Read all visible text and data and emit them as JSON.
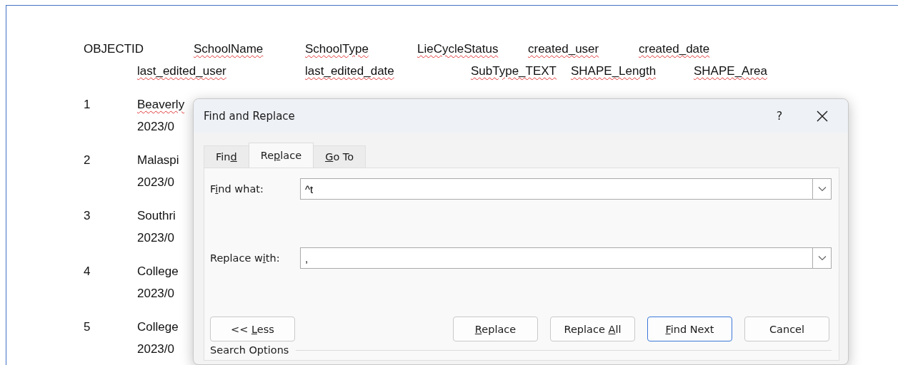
{
  "document": {
    "header_lines": [
      [
        {
          "text": "OBJECTID",
          "misspelled": false
        },
        {
          "text": "SchoolName",
          "misspelled": true
        },
        {
          "text": "SchoolType",
          "misspelled": true
        },
        {
          "text": "LieCycleStatus",
          "misspelled": true
        },
        {
          "text": "created_user",
          "misspelled": true
        },
        {
          "text": "created_date",
          "misspelled": true
        }
      ],
      [
        {
          "text": "last_edited_user",
          "misspelled": true
        },
        {
          "text": "last_edited_date",
          "misspelled": true
        },
        {
          "text": "SubType_TEXT",
          "misspelled": true
        },
        {
          "text": "SHAPE_Length",
          "misspelled": true
        },
        {
          "text": "SHAPE_Area",
          "misspelled": true
        }
      ]
    ],
    "rows": [
      {
        "id": "1",
        "name": "Beaverly",
        "misspelled": true,
        "date": "2023/0"
      },
      {
        "id": "2",
        "name": "Malaspi",
        "misspelled": false,
        "date": "2023/0"
      },
      {
        "id": "3",
        "name": "Southri",
        "misspelled": false,
        "date": "2023/0"
      },
      {
        "id": "4",
        "name": "College",
        "misspelled": false,
        "date": "2023/0"
      },
      {
        "id": "5",
        "name": "College",
        "misspelled": false,
        "date": "2023/0"
      }
    ]
  },
  "dialog": {
    "title": "Find and Replace",
    "help": "?",
    "tabs": [
      {
        "before": "Fin",
        "key": "d",
        "selected": false
      },
      {
        "before": "Re",
        "key": "p",
        "after": "lace",
        "selected": true
      },
      {
        "key": "G",
        "after": "o To",
        "selected": false
      }
    ],
    "fields": [
      {
        "before": "F",
        "key": "i",
        "after": "nd what:",
        "value": "^t"
      },
      {
        "before": "Replace w",
        "key": "i",
        "after": "th:",
        "value": ","
      }
    ],
    "buttons": [
      {
        "before": "<< ",
        "key": "L",
        "after": "ess",
        "default": false
      },
      {
        "key": "R",
        "after": "eplace",
        "default": false
      },
      {
        "before": "Replace ",
        "key": "A",
        "after": "ll",
        "default": false
      },
      {
        "key": "F",
        "after": "ind Next",
        "default": true
      },
      {
        "before": "Cancel",
        "default": false
      }
    ],
    "section": "Search Options"
  }
}
